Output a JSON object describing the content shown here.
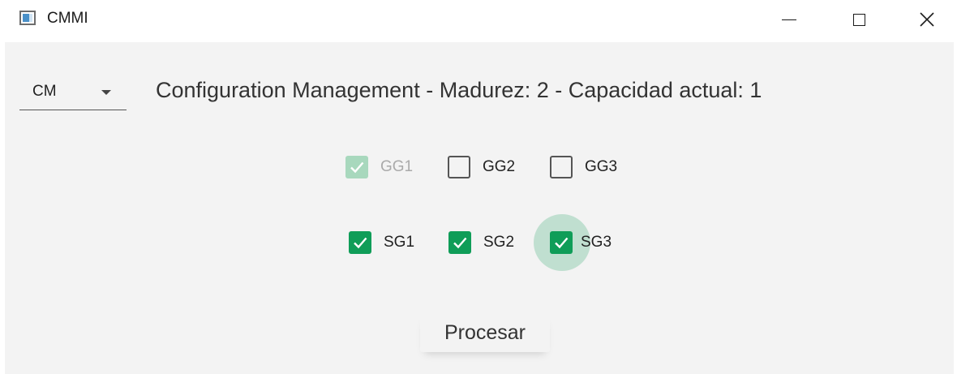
{
  "window": {
    "title": "CMMI",
    "icon": "app-window-icon",
    "controls": {
      "minimize_icon": "minimize-icon",
      "maximize_icon": "maximize-icon",
      "close_glyph": "✕"
    }
  },
  "combo": {
    "selected": "CM"
  },
  "header_text": "Configuration Management - Madurez: 2 - Capacidad actual: 1",
  "generic_goals": [
    {
      "label": "GG1",
      "checked": true,
      "enabled": false
    },
    {
      "label": "GG2",
      "checked": false,
      "enabled": true
    },
    {
      "label": "GG3",
      "checked": false,
      "enabled": true
    }
  ],
  "specific_goals": [
    {
      "label": "SG1",
      "checked": true,
      "enabled": true
    },
    {
      "label": "SG2",
      "checked": true,
      "enabled": true
    },
    {
      "label": "SG3",
      "checked": true,
      "enabled": true,
      "focused": true
    }
  ],
  "process_button_label": "Procesar",
  "colors": {
    "accent": "#0f9d58",
    "accent_disabled": "#a8d8bd",
    "background": "#f3f3f3"
  }
}
